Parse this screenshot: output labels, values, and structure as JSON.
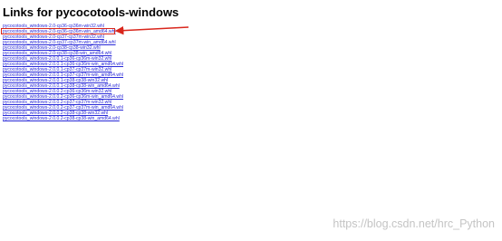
{
  "page": {
    "title": "Links for pycocotools-windows",
    "links": [
      "pycocotools_windows-2.0-cp36-cp36m-win32.whl",
      "pycocotools_windows-2.0-cp36-cp36m-win_amd64.whl",
      "pycocotools_windows-2.0-cp37-cp37m-win32.whl",
      "pycocotools_windows-2.0-cp37-cp37m-win_amd64.whl",
      "pycocotools_windows-2.0-cp38-cp38-win32.whl",
      "pycocotools_windows-2.0-cp38-cp38-win_amd64.whl",
      "pycocotools_windows-2.0.0.1-cp36-cp36m-win32.whl",
      "pycocotools_windows-2.0.0.1-cp36-cp36m-win_amd64.whl",
      "pycocotools_windows-2.0.0.1-cp37-cp37m-win32.whl",
      "pycocotools_windows-2.0.0.1-cp37-cp37m-win_amd64.whl",
      "pycocotools_windows-2.0.0.1-cp38-cp38-win32.whl",
      "pycocotools_windows-2.0.0.1-cp38-cp38-win_amd64.whl",
      "pycocotools_windows-2.0.0.2-cp36-cp36m-win32.whl",
      "pycocotools_windows-2.0.0.2-cp36-cp36m-win_amd64.whl",
      "pycocotools_windows-2.0.0.2-cp37-cp37m-win32.whl",
      "pycocotools_windows-2.0.0.2-cp37-cp37m-win_amd64.whl",
      "pycocotools_windows-2.0.0.2-cp38-cp38-win32.whl",
      "pycocotools_windows-2.0.0.2-cp38-cp38-win_amd64.whl"
    ],
    "highlighted_link_index": 1
  },
  "annotation": {
    "color": "#d9261c"
  },
  "watermark": {
    "text": "https://blog.csdn.net/hrc_Python"
  }
}
